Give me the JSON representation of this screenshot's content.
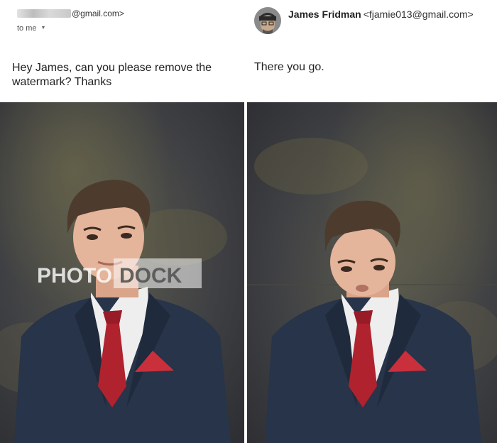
{
  "left_email": {
    "sender_domain": "@gmail.com>",
    "recipient": "to me",
    "message": "Hey James, can you please remove the watermark? Thanks"
  },
  "right_email": {
    "sender_name": "James Fridman",
    "sender_email": "<fjamie013@gmail.com>",
    "message": "There you go."
  },
  "watermark": {
    "text_left": "PHOTO",
    "text_right": "DOCK"
  },
  "icons": {
    "recipient_caret": "caret-down-icon",
    "avatar": "avatar-icon"
  }
}
